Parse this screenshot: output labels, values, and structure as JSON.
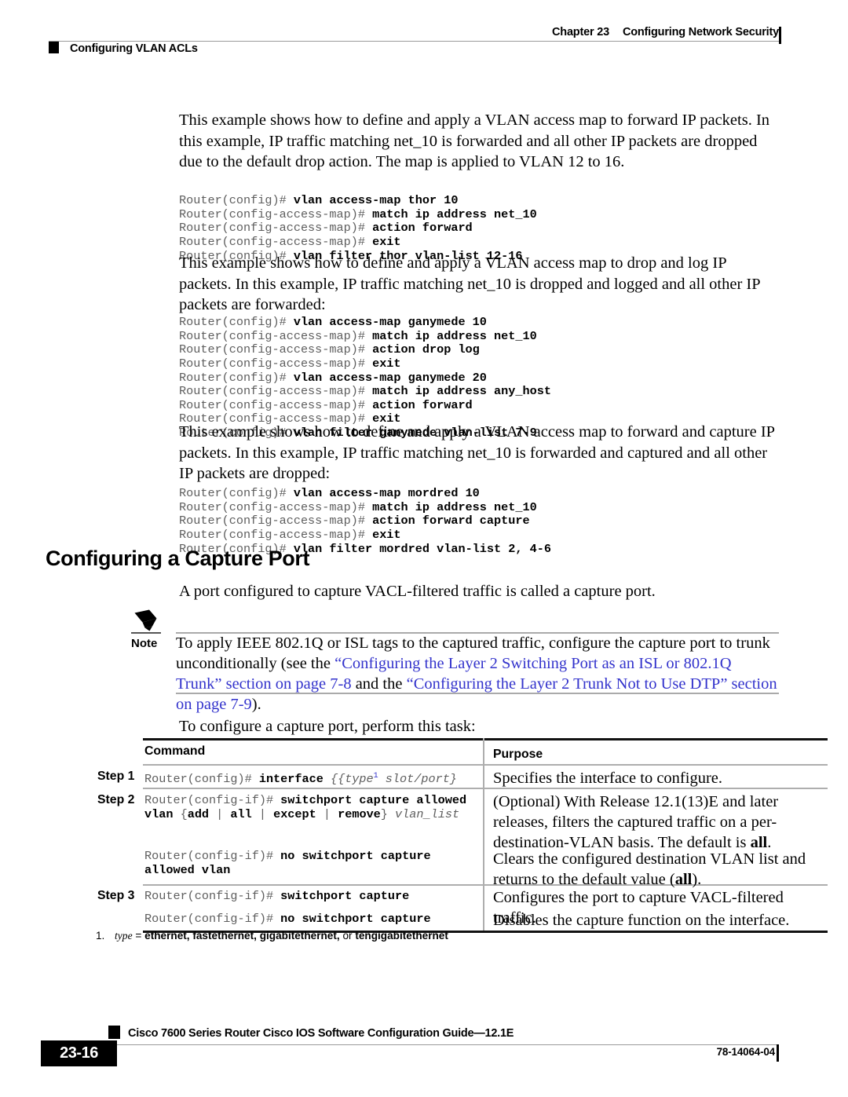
{
  "header": {
    "chapter_number": "Chapter 23",
    "chapter_title": "Configuring Network Security",
    "section_label": "Configuring VLAN ACLs"
  },
  "body": {
    "paragraph_1": "This example shows how to define and apply a VLAN access map to forward IP packets. In this example, IP traffic matching net_10 is forwarded and all other IP packets are dropped due to the default drop action. The map is applied to VLAN 12 to 16.",
    "paragraph_2": "This example shows how to define and apply a VLAN access map to drop and log IP packets. In this example, IP traffic matching net_10 is dropped and logged and all other IP packets are forwarded:",
    "paragraph_3": "This example shows how to define and apply a VLAN access map to forward and capture IP packets. In this example, IP traffic matching net_10 is forwarded and captured and all other IP packets are dropped:",
    "code_block_1": [
      {
        "prompt": "Router(config)# ",
        "command": "vlan access-map thor 10"
      },
      {
        "prompt": "Router(config-access-map)# ",
        "command": "match ip address net_10"
      },
      {
        "prompt": "Router(config-access-map)# ",
        "command": "action forward"
      },
      {
        "prompt": "Router(config-access-map)# ",
        "command": "exit"
      },
      {
        "prompt": "Router(config)# ",
        "command": "vlan filter thor vlan-list 12-16"
      }
    ],
    "code_block_2": [
      {
        "prompt": "Router(config)# ",
        "command": "vlan access-map ganymede 10"
      },
      {
        "prompt": "Router(config-access-map)# ",
        "command": "match ip address net_10"
      },
      {
        "prompt": "Router(config-access-map)# ",
        "command": "action drop log"
      },
      {
        "prompt": "Router(config-access-map)# ",
        "command": "exit"
      },
      {
        "prompt": "Router(config)# ",
        "command": "vlan access-map ganymede 20"
      },
      {
        "prompt": "Router(config-access-map)# ",
        "command": "match ip address any_host"
      },
      {
        "prompt": "Router(config-access-map)# ",
        "command": "action forward"
      },
      {
        "prompt": "Router(config-access-map)# ",
        "command": "exit"
      },
      {
        "prompt": "Router(config)# ",
        "command": "vlan filter ganymede vlan-list 7-9"
      }
    ],
    "code_block_3": [
      {
        "prompt": "Router(config)# ",
        "command": "vlan access-map mordred 10"
      },
      {
        "prompt": "Router(config-access-map)# ",
        "command": "match ip address net_10"
      },
      {
        "prompt": "Router(config-access-map)# ",
        "command": "action forward capture"
      },
      {
        "prompt": "Router(config-access-map)# ",
        "command": "exit"
      },
      {
        "prompt": "Router(config)# ",
        "command": "vlan filter mordred vlan-list 2, 4-6"
      }
    ],
    "section_heading": "Configuring a Capture Port",
    "capture_intro": "A port configured to capture VACL-filtered traffic is called a capture port.",
    "task_intro": "To configure a capture port, perform this task:"
  },
  "note": {
    "label": "Note",
    "icon": "pencil-icon",
    "text_1": "To apply IEEE 802.1Q or ISL tags to the captured traffic, configure the capture port to trunk unconditionally (see the ",
    "link_1": "“Configuring the Layer 2 Switching Port as an ISL or 802.1Q Trunk” section on page 7-8",
    "text_2": " and the ",
    "link_2": "“Configuring the Layer 2 Trunk Not to Use DTP” section on page 7-9",
    "text_3": ")."
  },
  "table": {
    "headers": {
      "command": "Command",
      "purpose": "Purpose"
    },
    "rows": [
      {
        "step": "Step 1",
        "command_lines": [
          {
            "prompt": "Router(config)# ",
            "bold": "interface ",
            "italic": "{{type",
            "sup": "1",
            "italic2": " slot/port}"
          }
        ],
        "purpose": "Specifies the interface to configure."
      },
      {
        "step": "Step 2",
        "command_lines": [
          {
            "prompt": "Router(config-if)# ",
            "bold": "switchport capture allowed vlan ",
            "plain": "{",
            "bold2": "add",
            "sep1": " | ",
            "bold3": "all",
            "sep2": " | ",
            "bold4": "except",
            "sep3": " | ",
            "bold5": "remove",
            "plain2": "} ",
            "italic": "vlan_list"
          }
        ],
        "purpose_pre": "(Optional) With Release 12.1(13)E and later releases, filters the captured traffic on a per-destination-VLAN basis. The default is ",
        "purpose_bold": "all",
        "purpose_post": "."
      },
      {
        "step": "",
        "command_lines": [
          {
            "prompt": "Router(config-if)# ",
            "bold": "no switchport capture allowed vlan"
          }
        ],
        "purpose_pre": "Clears the configured destination VLAN list and returns to the default value (",
        "purpose_bold": "all",
        "purpose_post": ")."
      },
      {
        "step": "Step 3",
        "command_lines": [
          {
            "prompt": "Router(config-if)# ",
            "bold": "switchport capture"
          }
        ],
        "purpose": "Configures the port to capture VACL-filtered traffic."
      },
      {
        "step": "",
        "command_lines": [
          {
            "prompt": "Router(config-if)# ",
            "bold": "no switchport capture"
          }
        ],
        "purpose": "Disables the capture function on the interface."
      }
    ]
  },
  "footnote": {
    "number": "1.",
    "term": "type",
    "equals": " = ",
    "values": "ethernet, fastethernet, gigabitethernet,",
    "or_word": " or ",
    "last_value": "tengigabitethernet"
  },
  "footer": {
    "doc_title": "Cisco 7600 Series Router Cisco IOS Software Configuration Guide—12.1E",
    "page_number": "23-16",
    "doc_id": "78-14064-04"
  },
  "colors": {
    "link": "#3333cc",
    "prompt_gray": "#5e5e5e",
    "rule_gray": "#aeaeae",
    "text": "#000000"
  }
}
